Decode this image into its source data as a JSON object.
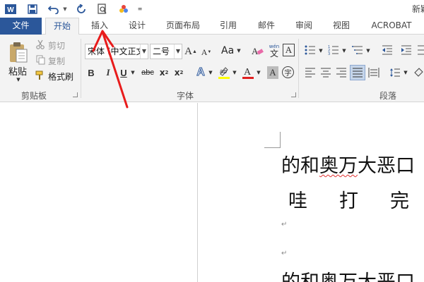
{
  "window": {
    "title": "新颖"
  },
  "tabs": [
    "文件",
    "开始",
    "插入",
    "设计",
    "页面布局",
    "引用",
    "邮件",
    "审阅",
    "视图",
    "ACROBAT"
  ],
  "clipboard": {
    "group_label": "剪贴板",
    "paste": "粘贴",
    "cut": "剪切",
    "copy": "复制",
    "format_painter": "格式刷"
  },
  "font": {
    "group_label": "字体",
    "font_name": "宋体 (中文正文",
    "font_size": "二号",
    "case_label": "Aa",
    "phonetic_label": "wén",
    "phonetic_char": "文",
    "border_char": "A"
  },
  "paragraph": {
    "group_label": "段落"
  },
  "document": {
    "line1": "的和奥万大恶口",
    "line1_squiggle": "奥万",
    "line2": [
      "哇",
      "打",
      "完"
    ],
    "line3": "的和奥万大恶口"
  }
}
